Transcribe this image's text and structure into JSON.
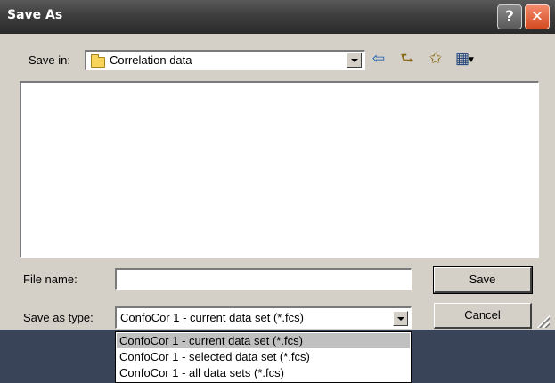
{
  "dialog": {
    "title": "Save As",
    "help_glyph": "?",
    "close_glyph": "✕"
  },
  "save_in": {
    "label": "Save in:",
    "value": "Correlation data",
    "folder_icon": "folder-icon"
  },
  "toolbar": {
    "back_icon": "back-arrow-icon",
    "up_icon": "up-folder-icon",
    "new_folder_icon": "new-folder-icon",
    "view_icon": "view-menu-icon"
  },
  "file_name": {
    "label": "File name:",
    "value": "",
    "placeholder": ""
  },
  "save_as_type": {
    "label": "Save as type:",
    "value": "ConfoCor 1 - current data set (*.fcs)",
    "options": [
      "ConfoCor 1 - current data set (*.fcs)",
      "ConfoCor 1 - selected data set (*.fcs)",
      "ConfoCor 1 - all data sets (*.fcs)"
    ],
    "highlighted_index": 0
  },
  "buttons": {
    "save_label": "Save",
    "cancel_label": "Cancel"
  },
  "colors": {
    "dialog_bg": "#d4d0c8",
    "close_button": "#d44a20",
    "titlebar": "#3e3e3e",
    "highlight": "#c0c0c0"
  }
}
